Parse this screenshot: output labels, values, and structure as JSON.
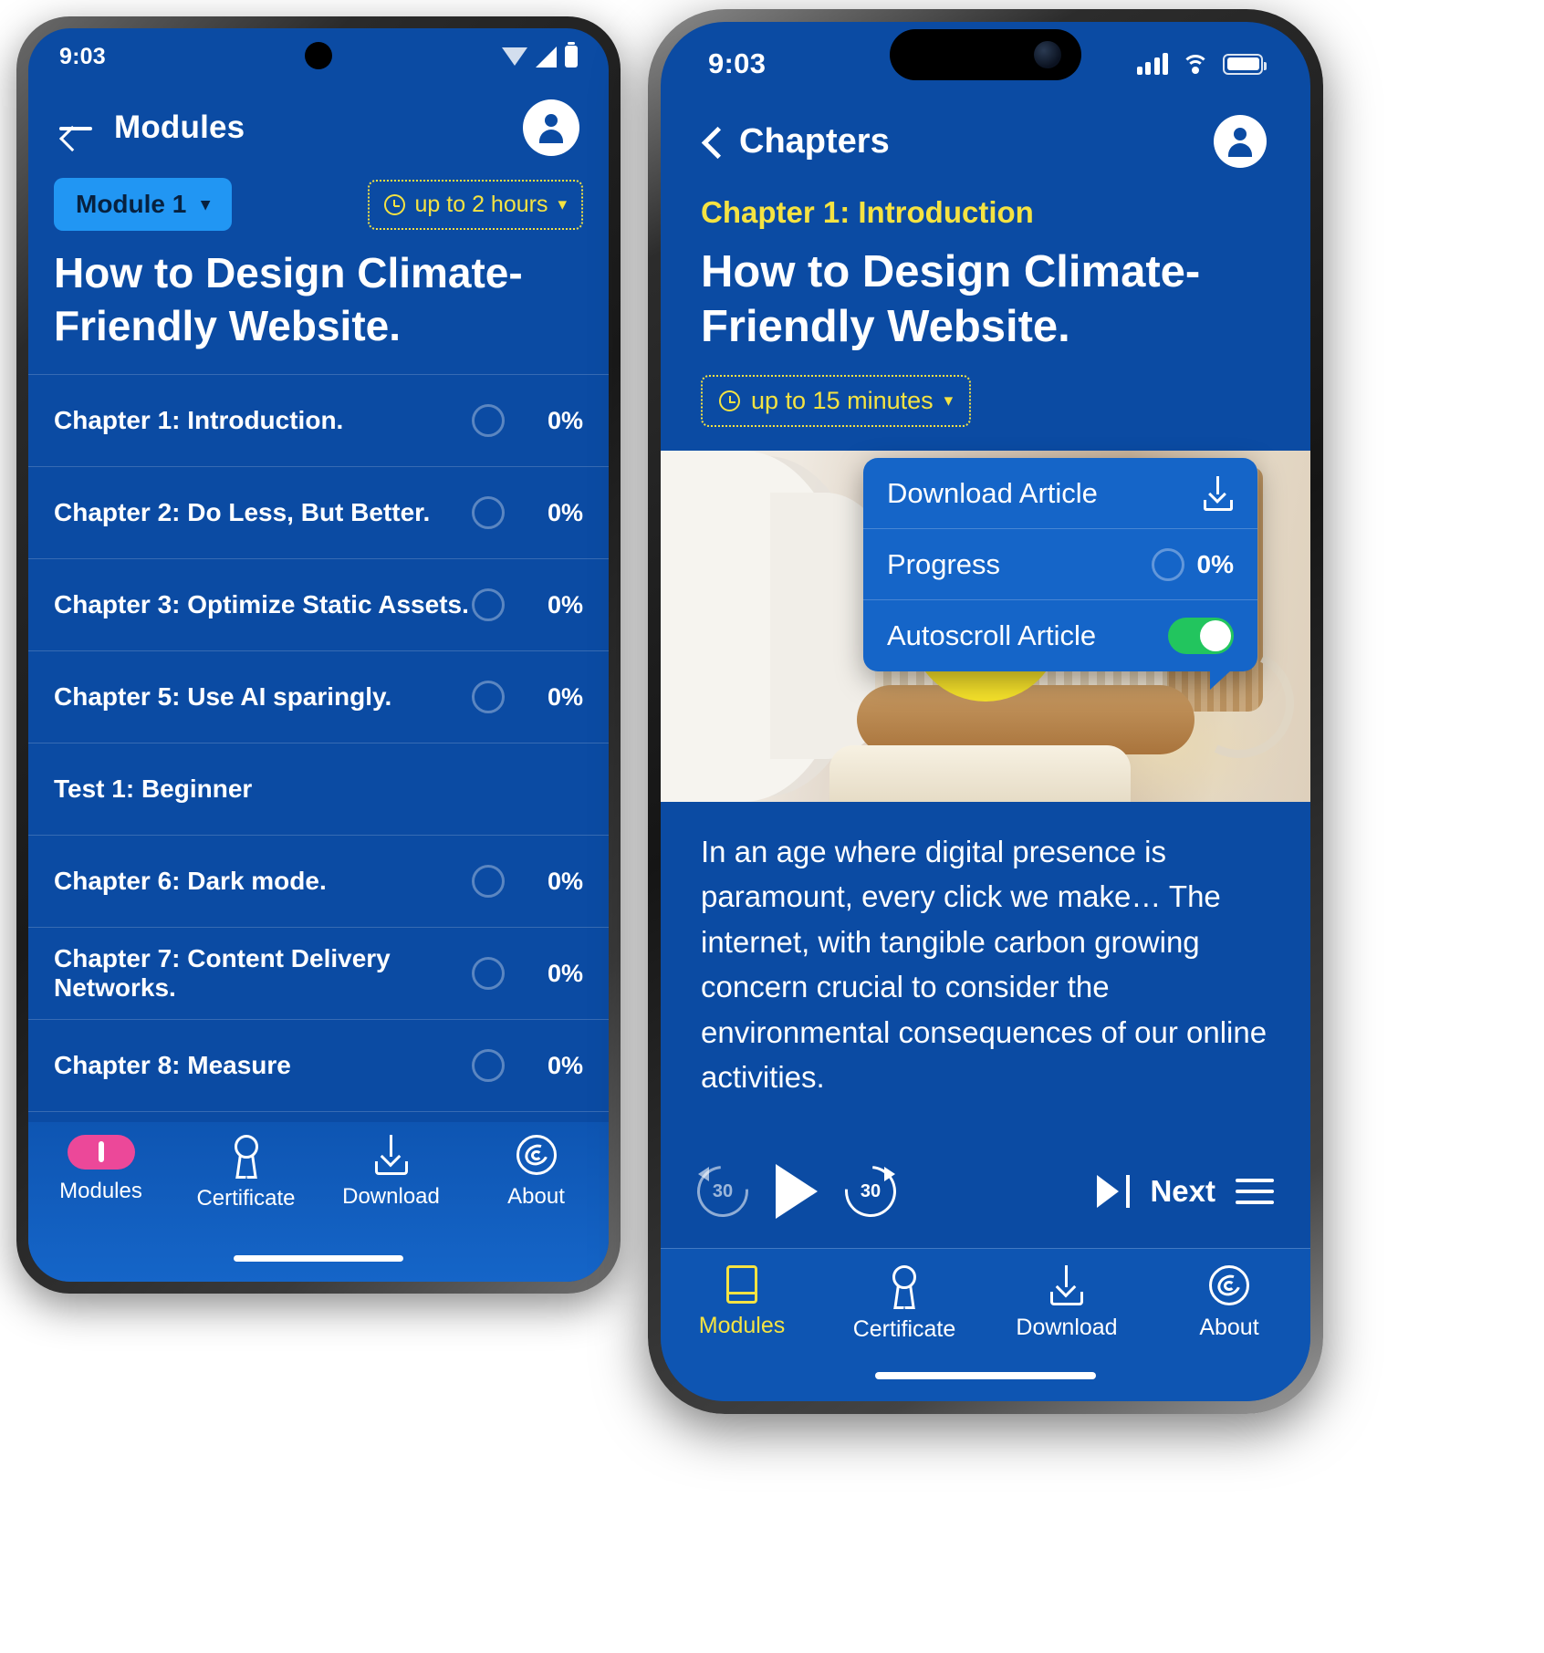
{
  "android": {
    "status": {
      "time": "9:03",
      "wifi_icon": "wifi-icon",
      "signal_icon": "signal-icon",
      "battery_icon": "battery-icon"
    },
    "appbar": {
      "back_icon": "back-arrow-icon",
      "title": "Modules",
      "avatar_icon": "account-avatar-icon"
    },
    "module_chip": {
      "label": "Module 1",
      "caret": "▾"
    },
    "duration_chip": {
      "clock_icon": "clock-icon",
      "label": "up to 2 hours",
      "caret": "▾"
    },
    "course_title": "How to Design Climate-Friendly Website.",
    "chapters": [
      {
        "name": "Chapter 1: Introduction.",
        "progress": "0%",
        "has_ring": true
      },
      {
        "name": "Chapter 2: Do Less, But Better.",
        "progress": "0%",
        "has_ring": true
      },
      {
        "name": "Chapter 3: Optimize Static Assets.",
        "progress": "0%",
        "has_ring": true
      },
      {
        "name": "Chapter 5: Use AI sparingly.",
        "progress": "0%",
        "has_ring": true
      },
      {
        "name": "Test 1: Beginner",
        "progress": "",
        "has_ring": false
      },
      {
        "name": "Chapter 6: Dark mode.",
        "progress": "0%",
        "has_ring": true
      },
      {
        "name": "Chapter 7: Content Delivery Networks.",
        "progress": "0%",
        "has_ring": true
      },
      {
        "name": "Chapter 8: Measure",
        "progress": "0%",
        "has_ring": true
      }
    ],
    "tabs": [
      {
        "label": "Modules",
        "icon": "book-icon",
        "active": true
      },
      {
        "label": "Certificate",
        "icon": "award-icon",
        "active": false
      },
      {
        "label": "Download",
        "icon": "download-icon",
        "active": false
      },
      {
        "label": "About",
        "icon": "spiral-icon",
        "active": false
      }
    ]
  },
  "ios": {
    "status": {
      "time": "9:03",
      "signal_icon": "cellular-bars-icon",
      "wifi_icon": "wifi-icon",
      "battery_icon": "battery-icon"
    },
    "navbar": {
      "back_icon": "chevron-left-icon",
      "title": "Chapters",
      "avatar_icon": "account-avatar-icon"
    },
    "eyebrow": "Chapter 1: Introduction",
    "heading": "How to Design Climate-Friendly Website.",
    "duration_chip": {
      "clock_icon": "clock-icon",
      "label": "up to 15 minutes",
      "caret": "▾"
    },
    "video": {
      "play_icon": "play-icon"
    },
    "article_text": "In an age where digital presence is paramount, every click we make… The internet, with tangible carbon growing concern crucial to consider the environmental consequences of our online activities.",
    "popup": {
      "items": [
        {
          "label": "Download Article",
          "icon": "download-icon",
          "type": "action"
        },
        {
          "label": "Progress",
          "value": "0%",
          "icon": "progress-ring-icon",
          "type": "value"
        },
        {
          "label": "Autoscroll Article",
          "toggle_on": true,
          "type": "toggle"
        }
      ]
    },
    "player": {
      "rewind_label": "30",
      "forward_label": "30",
      "play_icon": "play-icon",
      "next_icon": "skip-next-icon",
      "next_label": "Next",
      "menu_icon": "hamburger-menu-icon"
    },
    "tabs": [
      {
        "label": "Modules",
        "icon": "book-icon",
        "active": true
      },
      {
        "label": "Certificate",
        "icon": "award-icon",
        "active": false
      },
      {
        "label": "Download",
        "icon": "download-icon",
        "active": false
      },
      {
        "label": "About",
        "icon": "spiral-icon",
        "active": false
      }
    ]
  },
  "colors": {
    "brand_blue": "#0b4ba3",
    "accent_yellow": "#f5e342",
    "chip_blue": "#2196f3",
    "active_pink": "#ec4899",
    "toggle_green": "#22c55e"
  }
}
